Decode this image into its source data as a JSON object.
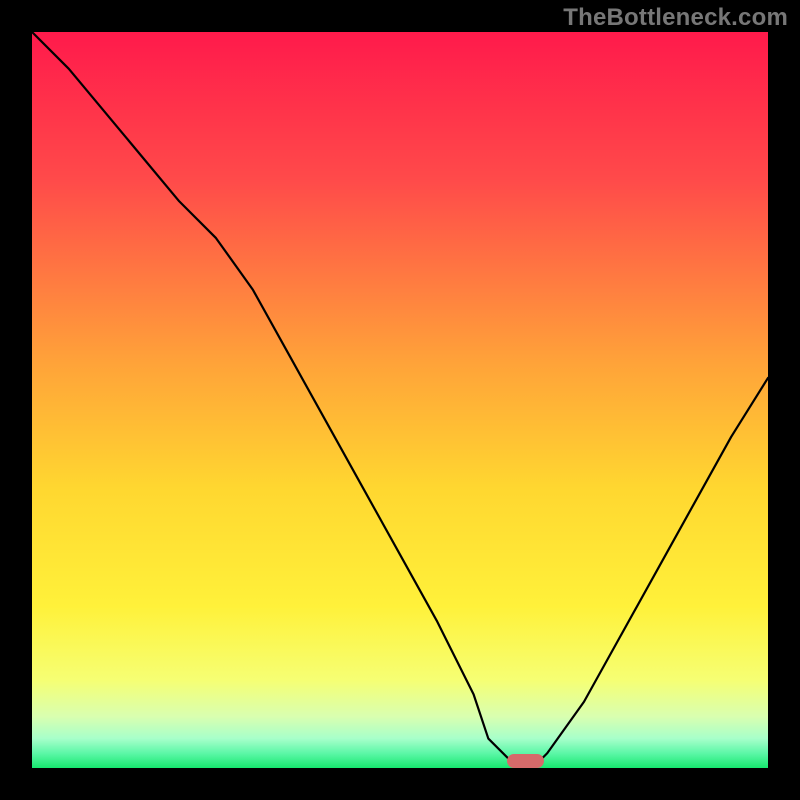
{
  "chart_data": {
    "type": "line",
    "watermark": "TheBottleneck.com",
    "xlim": [
      0,
      100
    ],
    "ylim": [
      0,
      100
    ],
    "x": [
      0,
      5,
      10,
      15,
      20,
      25,
      30,
      35,
      40,
      45,
      50,
      55,
      60,
      62,
      65,
      68,
      70,
      75,
      80,
      85,
      90,
      95,
      100
    ],
    "values": [
      100,
      95,
      89,
      83,
      77,
      72,
      65,
      56,
      47,
      38,
      29,
      20,
      10,
      4,
      1,
      0,
      2,
      9,
      18,
      27,
      36,
      45,
      53
    ],
    "minimum_x": 67,
    "minimum_span": 5,
    "colors": {
      "curve": "#000000",
      "marker": "#d66a6a",
      "gradient_top": "#ff1a4b",
      "gradient_bottom": "#17e86f"
    }
  }
}
